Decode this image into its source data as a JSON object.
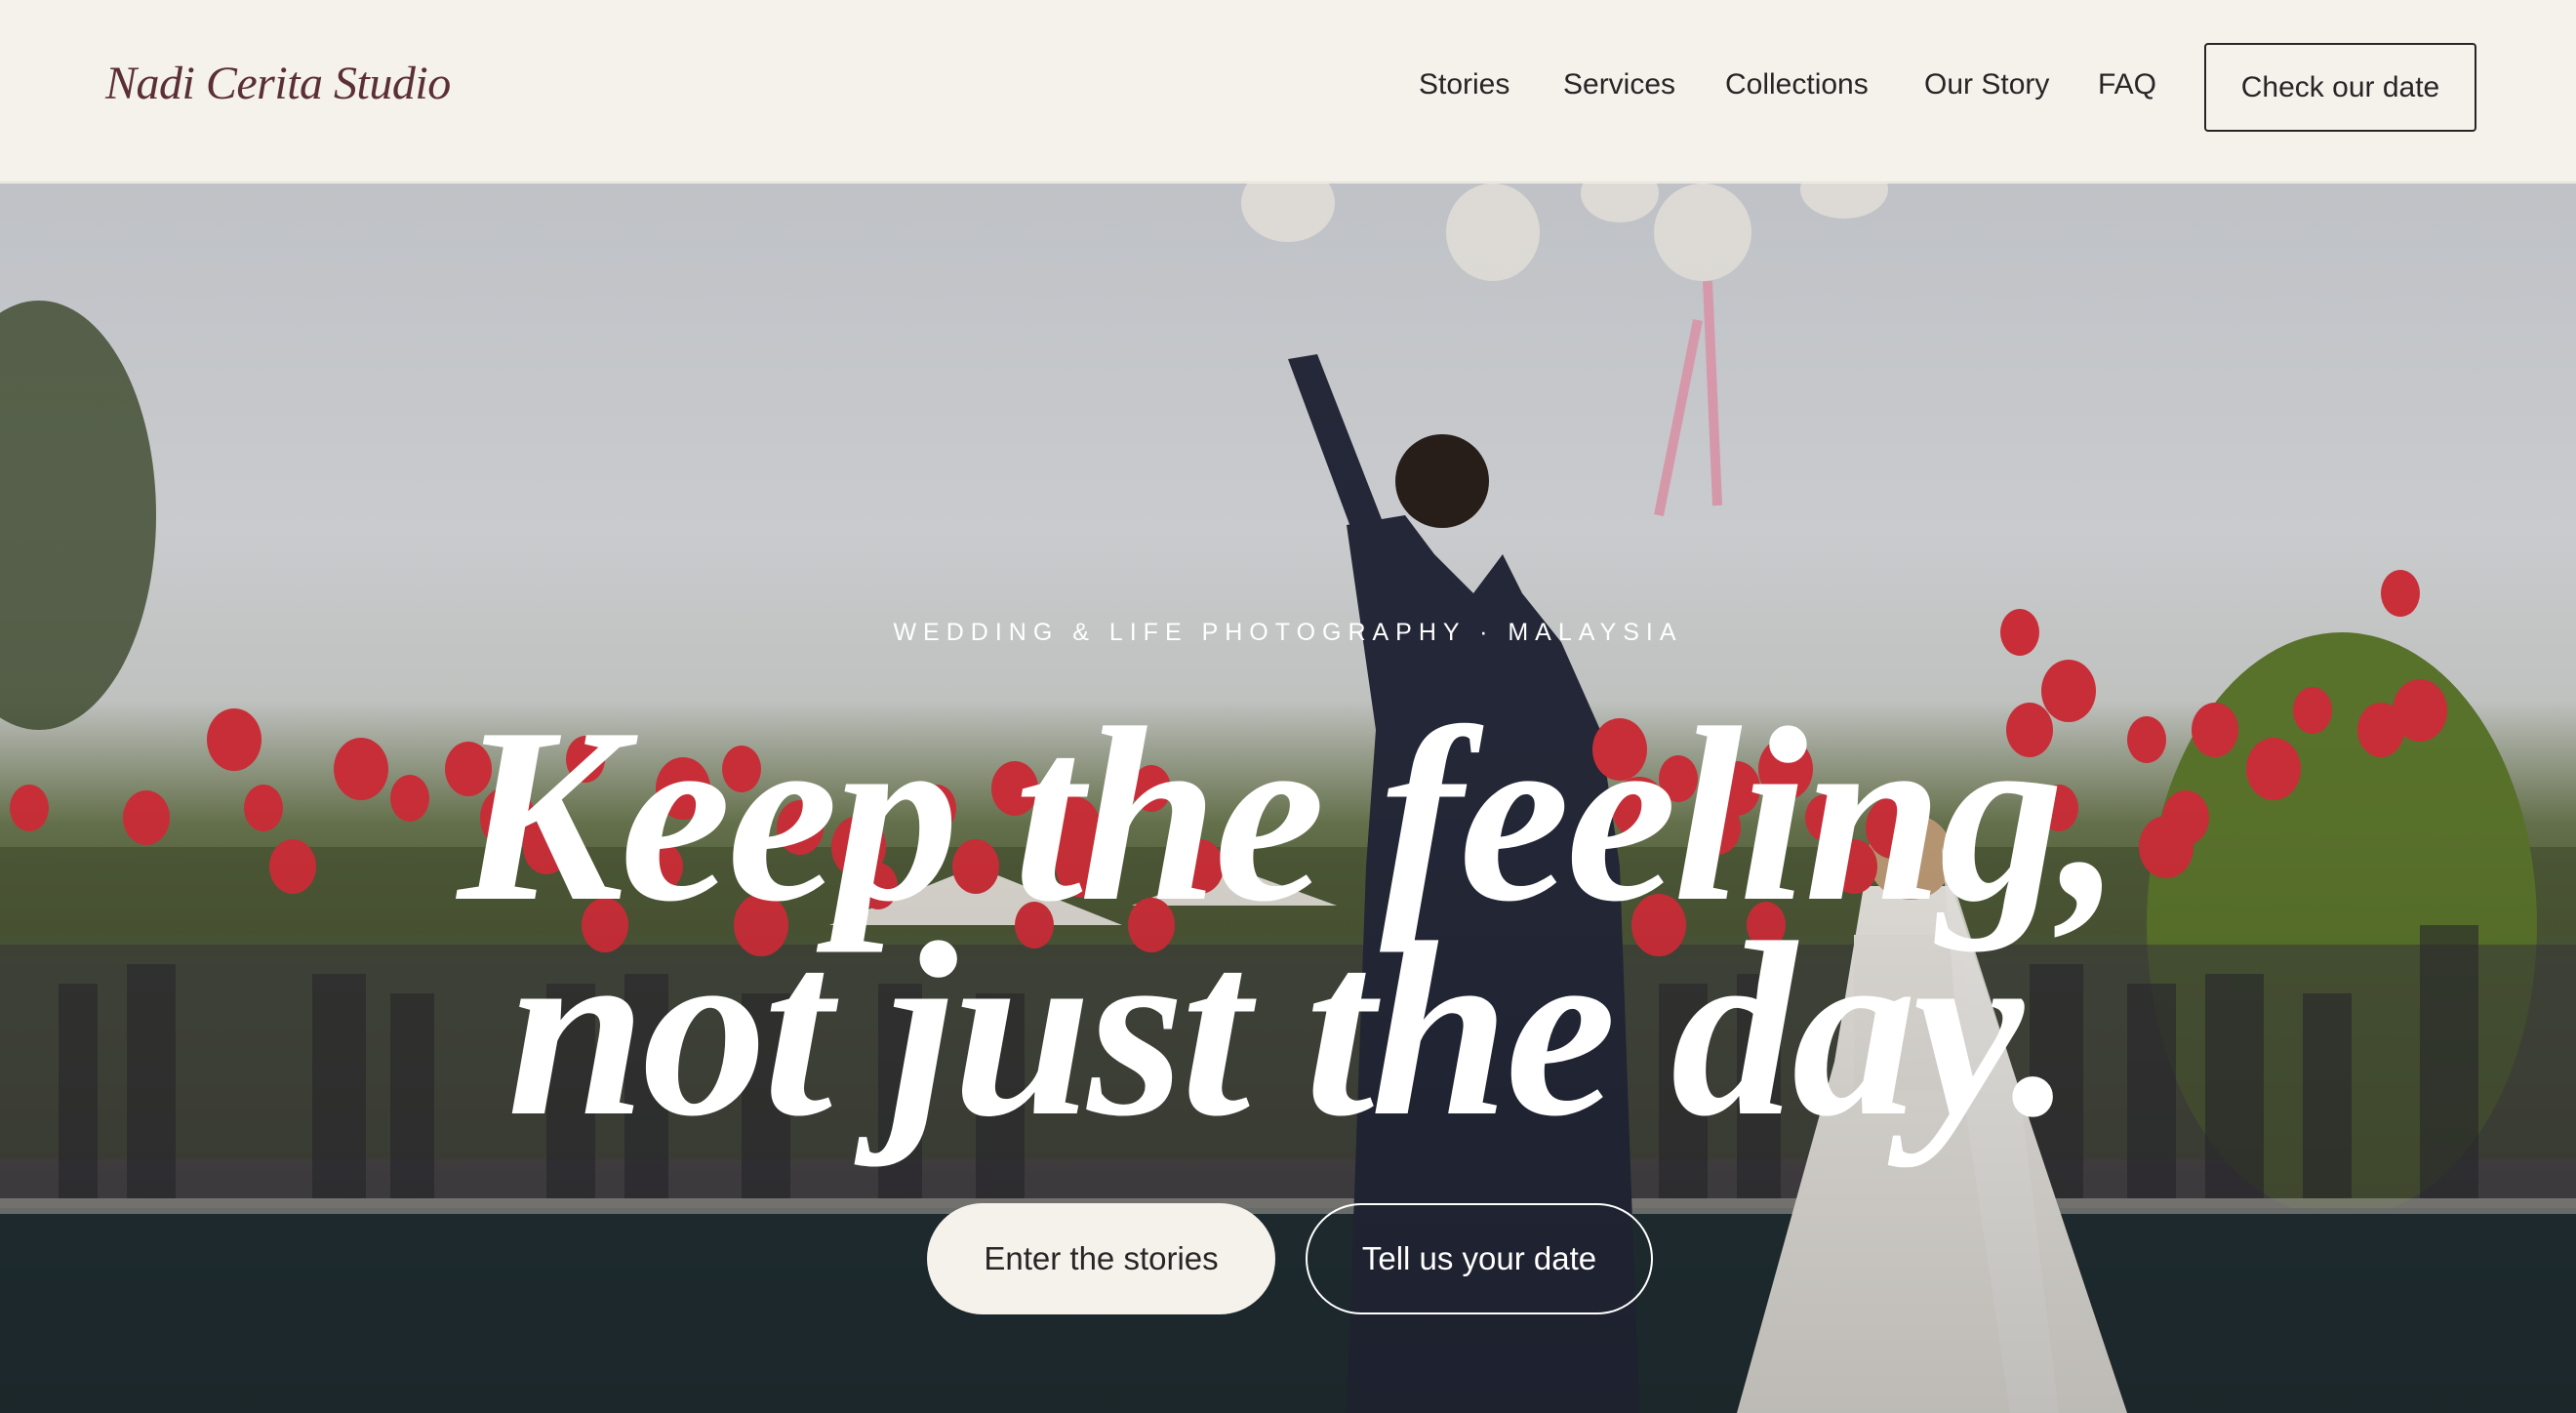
{
  "brand": {
    "name": "Nadi Cerita Studio",
    "color": "#5b2f36"
  },
  "nav": {
    "items": [
      {
        "label": "Stories"
      },
      {
        "label": "Services"
      },
      {
        "label": "Collections"
      },
      {
        "label": "Our Story"
      },
      {
        "label": "FAQ"
      }
    ],
    "cta_label": "Check our date"
  },
  "hero": {
    "eyebrow": "WEDDING & LIFE PHOTOGRAPHY · MALAYSIA",
    "headline_line1": "Keep the feeling,",
    "headline_line2": "not just the day.",
    "primary_button": "Enter the stories",
    "secondary_button": "Tell us your date",
    "image_description_icon": "wedding-photo",
    "balloon_color": "#d8323c"
  },
  "colors": {
    "header_bg": "#f5f1eb",
    "text_dark": "#2a2426",
    "hero_text": "#ffffff"
  }
}
